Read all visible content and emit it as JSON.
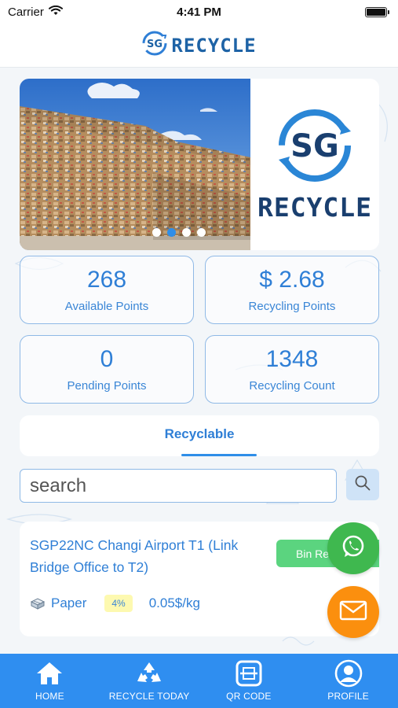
{
  "status_bar": {
    "carrier": "Carrier",
    "time": "4:41 PM"
  },
  "header": {
    "logo_text": "SG",
    "brand": "RECYCLE"
  },
  "banner": {
    "logo_text": "SG",
    "brand": "RECYCLE",
    "slide_count": 4,
    "active_slide": 2
  },
  "stats": [
    {
      "value": "268",
      "label": "Available Points"
    },
    {
      "value": "$ 2.68",
      "label": "Recycling Points"
    },
    {
      "value": "0",
      "label": "Pending Points"
    },
    {
      "value": "1348",
      "label": "Recycling Count"
    }
  ],
  "tabs": {
    "active_label": "Recyclable"
  },
  "search": {
    "placeholder": "search",
    "value": ""
  },
  "bin": {
    "title": "SGP22NC Changi Airport T1 (Link Bridge Office to T2)",
    "button_label": "Bin Re",
    "material": "Paper",
    "material_icon": "paper-stack-icon",
    "percent": "4%",
    "rate": "0.05$/kg"
  },
  "fabs": {
    "whatsapp_icon": "whatsapp-icon",
    "mail_icon": "mail-icon"
  },
  "nav": {
    "items": [
      {
        "label": "HOME",
        "icon": "home-icon"
      },
      {
        "label": "RECYCLE TODAY",
        "icon": "recycle-icon"
      },
      {
        "label": "QR CODE",
        "icon": "qr-scan-icon"
      },
      {
        "label": "PROFILE",
        "icon": "profile-icon"
      }
    ]
  },
  "colors": {
    "primary": "#2f8ef0",
    "accent_text": "#2f7fd6",
    "whatsapp": "#3fb84f",
    "mail": "#fb8f0e",
    "bin_button": "#5bd47f",
    "badge": "#fdf9b0"
  }
}
